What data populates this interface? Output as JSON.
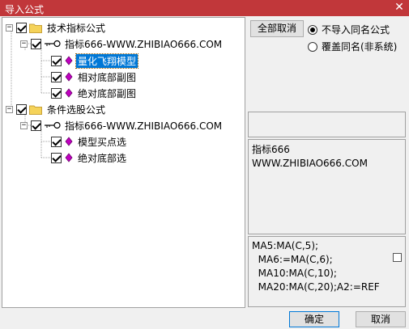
{
  "window": {
    "title": "导入公式",
    "close_glyph": "✕"
  },
  "tree": {
    "group1": {
      "label": "技术指标公式",
      "source": "指标666-WWW.ZHIBIAO666.COM",
      "items": [
        "量化飞翔模型",
        "相对底部副图",
        "绝对底部副图"
      ]
    },
    "group2": {
      "label": "条件选股公式",
      "source": "指标666-WWW.ZHIBIAO666.COM",
      "items": [
        "模型买点选",
        "绝对底部选"
      ]
    }
  },
  "options": {
    "cancel_all_label": "全部取消",
    "no_import_same_label": "不导入同名公式",
    "overwrite_label": "覆盖同名(非系统)",
    "selected": "no_import_same"
  },
  "info": {
    "line1": "指标666",
    "line2": "WWW.ZHIBIAO666.COM"
  },
  "code": {
    "lines": [
      "MA5:MA(C,5);",
      "  MA6:=MA(C,6);",
      "  MA10:MA(C,10);",
      "  MA20:MA(C,20);A2:=REF"
    ]
  },
  "footer": {
    "ok_label": "确定",
    "cancel_label": "取消"
  },
  "colors": {
    "titlebar": "#c1373a",
    "selection": "#0078d7",
    "diamond": "#c000c0",
    "folder": "#f5d35a"
  }
}
